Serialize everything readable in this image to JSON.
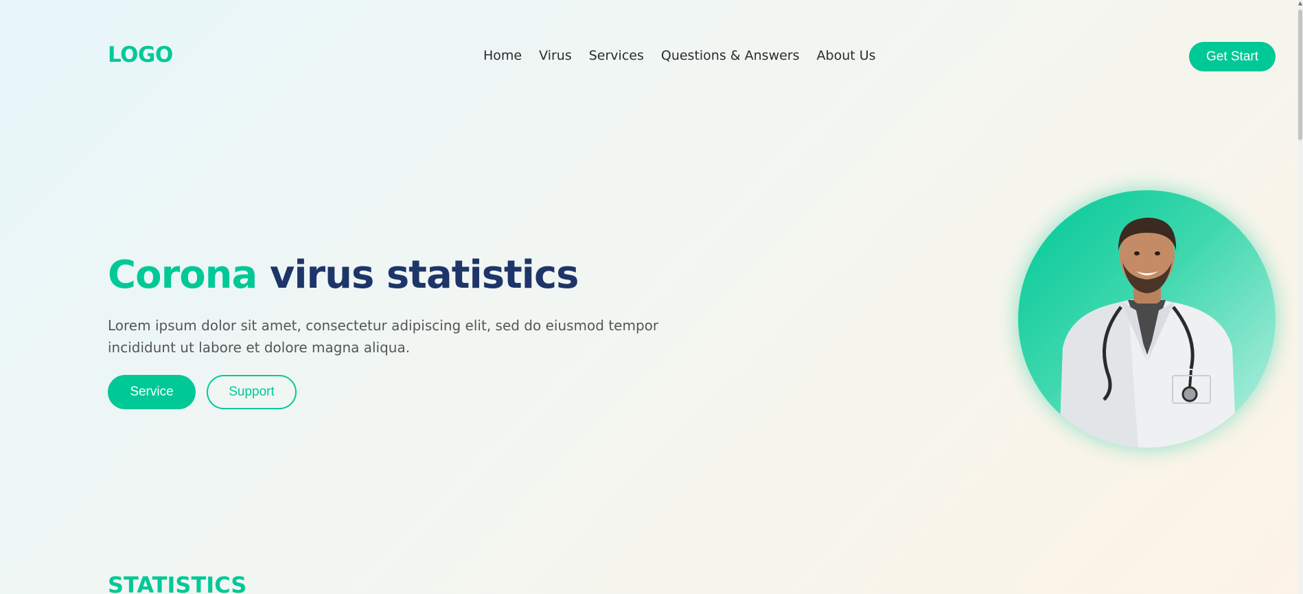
{
  "header": {
    "logo": "LOGO",
    "nav": [
      "Home",
      "Virus",
      "Services",
      "Questions & Answers",
      "About Us"
    ],
    "cta": "Get Start"
  },
  "hero": {
    "title_accent": "Corona",
    "title_rest": " virus statistics",
    "description": "Lorem ipsum dolor sit amet, consectetur adipiscing elit, sed do eiusmod tempor incididunt ut labore et dolore magna aliqua.",
    "buttons": {
      "primary": "Service",
      "secondary": "Support"
    },
    "image_icon": "doctor-portrait"
  },
  "stats": {
    "title": "STATISTICS"
  },
  "colors": {
    "accent": "#00c896",
    "navy": "#1e3569"
  }
}
